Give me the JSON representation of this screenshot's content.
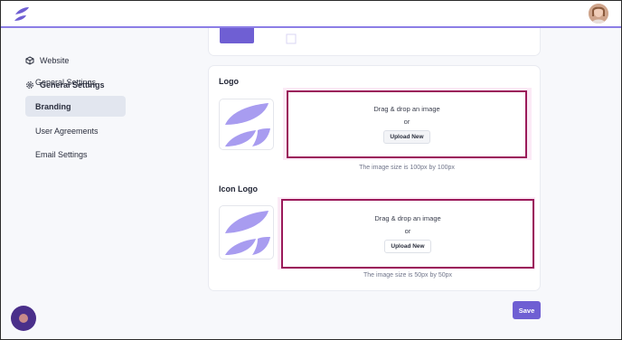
{
  "colors": {
    "accent": "#6f5fd3",
    "drop_border": "#9b1a5a",
    "drop_highlight": "#fbeaf6",
    "logo_light": "#a89cf0",
    "logo_dark": "#5b49c9"
  },
  "header": {
    "brand_icon": "feather-logo-icon",
    "avatar_icon": "user-avatar"
  },
  "sidebar": {
    "website": {
      "label": "Website",
      "icon": "cube-icon"
    },
    "general_settings": {
      "label": "General Settings",
      "icon": "gear-icon"
    },
    "items": [
      {
        "label": "General Settings",
        "active": false
      },
      {
        "label": "Branding",
        "active": true
      },
      {
        "label": "User Agreements",
        "active": false
      },
      {
        "label": "Email Settings",
        "active": false
      }
    ]
  },
  "logo_section": {
    "title": "Logo",
    "drop_text": "Drag & drop an image",
    "or_text": "or",
    "upload_label": "Upload New",
    "size_note": "The image size is 100px by 100px"
  },
  "icon_logo_section": {
    "title": "Icon Logo",
    "drop_text": "Drag & drop an image",
    "or_text": "or",
    "upload_label": "Upload New",
    "size_note": "The image size is 50px by 50px"
  },
  "actions": {
    "save_label": "Save"
  },
  "chat": {
    "icon": "chat-launcher-icon"
  }
}
